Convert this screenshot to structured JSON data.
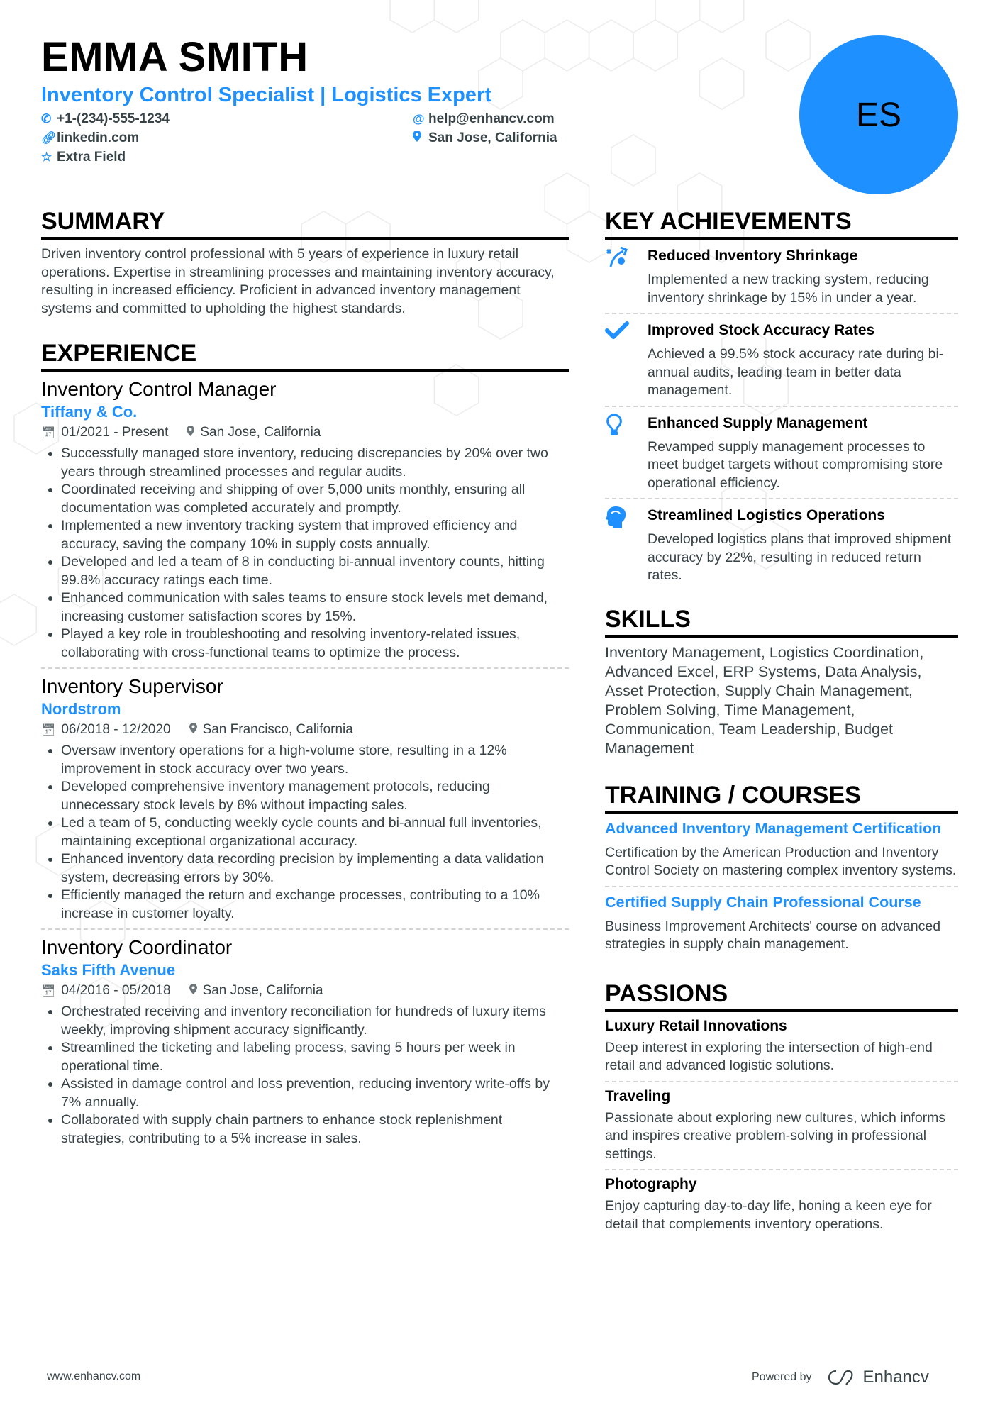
{
  "header": {
    "name": "EMMA SMITH",
    "title": "Inventory Control Specialist | Logistics Expert",
    "initials": "ES",
    "accent_color": "#1e90ff",
    "contacts": {
      "phone": "+1-(234)-555-1234",
      "email": "help@enhancv.com",
      "linkedin": "linkedin.com",
      "location": "San Jose, California",
      "extra": "Extra Field"
    }
  },
  "summary": {
    "heading": "SUMMARY",
    "text": "Driven inventory control professional with 5 years of experience in luxury retail operations. Expertise in streamlining processes and maintaining inventory accuracy, resulting in increased efficiency. Proficient in advanced inventory management systems and committed to upholding the highest standards."
  },
  "experience": {
    "heading": "EXPERIENCE",
    "items": [
      {
        "title": "Inventory Control Manager",
        "company": "Tiffany & Co.",
        "dates": "01/2021 - Present",
        "location": "San Jose, California",
        "bullets": [
          "Successfully managed store inventory, reducing discrepancies by 20% over two years through streamlined processes and regular audits.",
          "Coordinated receiving and shipping of over 5,000 units monthly, ensuring all documentation was completed accurately and promptly.",
          "Implemented a new inventory tracking system that improved efficiency and accuracy, saving the company 10% in supply costs annually.",
          "Developed and led a team of 8 in conducting bi-annual inventory counts, hitting 99.8% accuracy ratings each time.",
          "Enhanced communication with sales teams to ensure stock levels met demand, increasing customer satisfaction scores by 15%.",
          "Played a key role in troubleshooting and resolving inventory-related issues, collaborating with cross-functional teams to optimize the process."
        ]
      },
      {
        "title": "Inventory Supervisor",
        "company": "Nordstrom",
        "dates": "06/2018 - 12/2020",
        "location": "San Francisco, California",
        "bullets": [
          "Oversaw inventory operations for a high-volume store, resulting in a 12% improvement in stock accuracy over two years.",
          "Developed comprehensive inventory management protocols, reducing unnecessary stock levels by 8% without impacting sales.",
          "Led a team of 5, conducting weekly cycle counts and bi-annual full inventories, maintaining exceptional organizational accuracy.",
          "Enhanced inventory data recording precision by implementing a data validation system, decreasing errors by 30%.",
          "Efficiently managed the return and exchange processes, contributing to a 10% increase in customer loyalty."
        ]
      },
      {
        "title": "Inventory Coordinator",
        "company": "Saks Fifth Avenue",
        "dates": "04/2016 - 05/2018",
        "location": "San Jose, California",
        "bullets": [
          "Orchestrated receiving and inventory reconciliation for hundreds of luxury items weekly, improving shipment accuracy significantly.",
          "Streamlined the ticketing and labeling process, saving 5 hours per week in operational time.",
          "Assisted in damage control and loss prevention, reducing inventory write-offs by 7% annually.",
          "Collaborated with supply chain partners to enhance stock replenishment strategies, contributing to a 5% increase in sales."
        ]
      }
    ]
  },
  "achievements": {
    "heading": "KEY ACHIEVEMENTS",
    "items": [
      {
        "icon": "strategy-icon",
        "title": "Reduced Inventory Shrinkage",
        "desc": "Implemented a new tracking system, reducing inventory shrinkage by 15% in under a year."
      },
      {
        "icon": "checkmark-icon",
        "title": "Improved Stock Accuracy Rates",
        "desc": "Achieved a 99.5% stock accuracy rate during bi-annual audits, leading team in better data management."
      },
      {
        "icon": "lightbulb-icon",
        "title": "Enhanced Supply Management",
        "desc": "Revamped supply management processes to meet budget targets without compromising store operational efficiency."
      },
      {
        "icon": "head-brain-icon",
        "title": "Streamlined Logistics Operations",
        "desc": "Developed logistics plans that improved shipment accuracy by 22%, resulting in reduced return rates."
      }
    ]
  },
  "skills": {
    "heading": "SKILLS",
    "text": "Inventory Management, Logistics Coordination, Advanced Excel, ERP Systems, Data Analysis, Asset Protection, Supply Chain Management, Problem Solving, Time Management, Communication, Team Leadership, Budget Management"
  },
  "training": {
    "heading": "TRAINING / COURSES",
    "items": [
      {
        "title": "Advanced Inventory Management Certification",
        "desc": "Certification by the American Production and Inventory Control Society on mastering complex inventory systems."
      },
      {
        "title": "Certified Supply Chain Professional Course",
        "desc": "Business Improvement Architects' course on advanced strategies in supply chain management."
      }
    ]
  },
  "passions": {
    "heading": "PASSIONS",
    "items": [
      {
        "title": "Luxury Retail Innovations",
        "desc": "Deep interest in exploring the intersection of high-end retail and advanced logistic solutions."
      },
      {
        "title": "Traveling",
        "desc": "Passionate about exploring new cultures, which informs and inspires creative problem-solving in professional settings."
      },
      {
        "title": "Photography",
        "desc": "Enjoy capturing day-to-day life, honing a keen eye for detail that complements inventory operations."
      }
    ]
  },
  "footer": {
    "website": "www.enhancv.com",
    "powered_by": "Powered by",
    "brand": "Enhancv"
  }
}
